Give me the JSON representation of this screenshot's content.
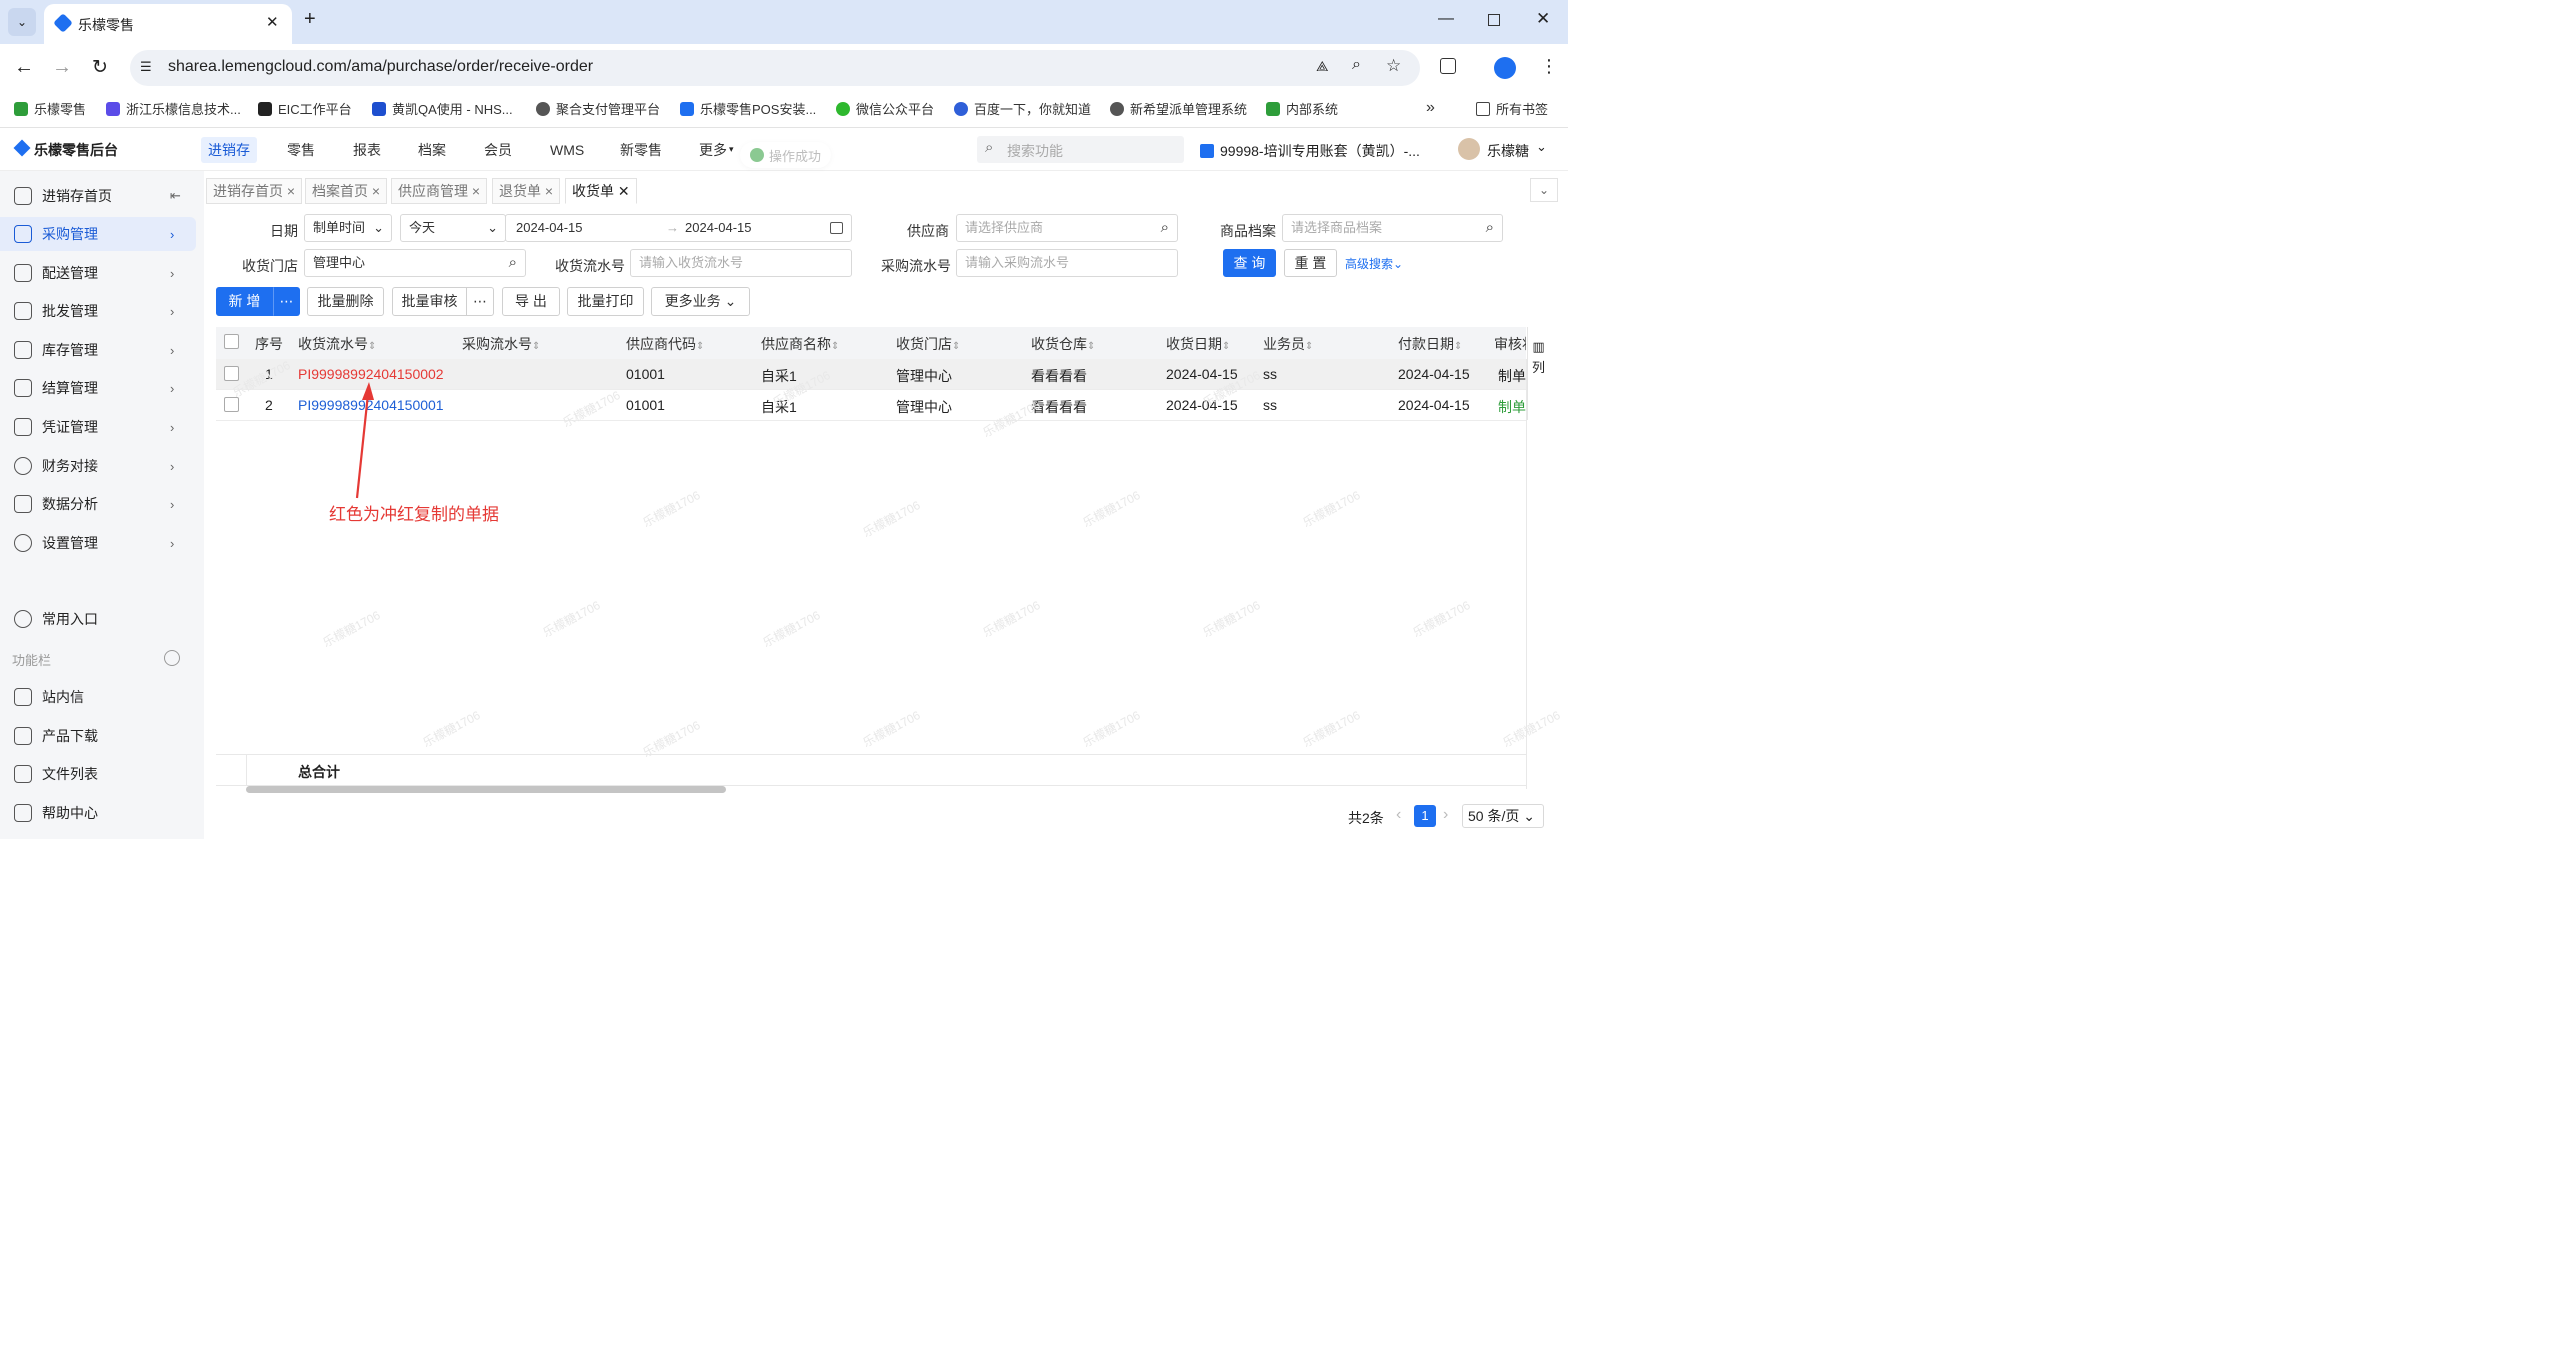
{
  "browser": {
    "tab_title": "乐檬零售",
    "url": "sharea.lemengcloud.com/ama/purchase/order/receive-order",
    "bookmarks": [
      "乐檬零售",
      "浙江乐檬信息技术...",
      "EIC工作平台",
      "黄凯QA使用 - NHS...",
      "聚合支付管理平台",
      "乐檬零售POS安装...",
      "微信公众平台",
      "百度一下，你就知道",
      "新希望派单管理系统",
      "内部系统"
    ],
    "all_bookmarks": "所有书签",
    "more_glyph": "»"
  },
  "app": {
    "logo": "乐檬零售后台",
    "nav": [
      "进销存",
      "零售",
      "报表",
      "档案",
      "会员",
      "WMS",
      "新零售",
      "更多"
    ],
    "toast": "操作成功",
    "search_placeholder": "搜索功能",
    "account": "99998-培训专用账套（黄凯）-...",
    "user": "乐檬糖"
  },
  "sidebar": {
    "items": [
      "进销存首页",
      "采购管理",
      "配送管理",
      "批发管理",
      "库存管理",
      "结算管理",
      "凭证管理",
      "财务对接",
      "数据分析",
      "设置管理"
    ],
    "common": "常用入口",
    "section": "功能栏",
    "bottom": [
      "站内信",
      "产品下载",
      "文件列表",
      "帮助中心"
    ]
  },
  "page_tabs": [
    "进销存首页",
    "档案首页",
    "供应商管理",
    "退货单",
    "收货单"
  ],
  "filters": {
    "date_label": "日期",
    "date_type": "制单时间",
    "date_range": "今天",
    "date_from": "2024-04-15",
    "date_to": "2024-04-15",
    "supplier_label": "供应商",
    "supplier_ph": "请选择供应商",
    "item_label": "商品档案",
    "item_ph": "请选择商品档案",
    "store_label": "收货门店",
    "store_value": "管理中心",
    "recv_no_label": "收货流水号",
    "recv_no_ph": "请输入收货流水号",
    "po_no_label": "采购流水号",
    "po_no_ph": "请输入采购流水号",
    "query": "查 询",
    "reset": "重 置",
    "advanced": "高级搜索"
  },
  "toolbar": [
    "新 增",
    "批量删除",
    "批量审核",
    "导 出",
    "批量打印",
    "更多业务"
  ],
  "table": {
    "columns": [
      "序号",
      "收货流水号",
      "采购流水号",
      "供应商代码",
      "供应商名称",
      "收货门店",
      "收货仓库",
      "收货日期",
      "业务员",
      "付款日期",
      "审核状态"
    ],
    "rows": [
      {
        "idx": "1",
        "recv_no": "PI99998992404150002",
        "po_no": "",
        "sup_code": "01001",
        "sup_name": "自采1",
        "store": "管理中心",
        "warehouse": "看看看看",
        "date": "2024-04-15",
        "clerk": "ss",
        "pay_date": "2024-04-15",
        "status": "制单"
      },
      {
        "idx": "2",
        "recv_no": "PI99998992404150001",
        "po_no": "",
        "sup_code": "01001",
        "sup_name": "自采1",
        "store": "管理中心",
        "warehouse": "看看看看",
        "date": "2024-04-15",
        "clerk": "ss",
        "pay_date": "2024-04-15",
        "status": "制单"
      }
    ],
    "total_label": "总合计",
    "col_setting": "列"
  },
  "annotation": "红色为冲红复制的单据",
  "pager": {
    "total": "共2条",
    "page": "1",
    "size": "50 条/页"
  },
  "watermark": "乐檬糖1706",
  "colors": {
    "accent": "#1e6ff0",
    "red": "#e53935",
    "green": "#2e9d3a"
  }
}
